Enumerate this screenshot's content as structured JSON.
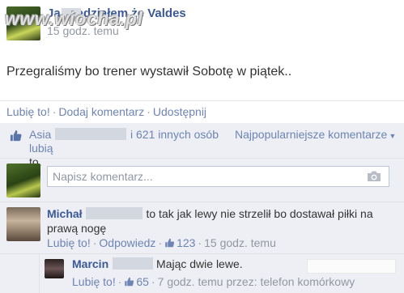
{
  "post": {
    "author": "Ja        wiedziałem że Valdes",
    "time": "15 godz. temu",
    "watermark": "www.wiocha.pl",
    "text": "Przegraliśmy bo trener wystawił Sobotę w piątek.."
  },
  "actions": {
    "like": "Lubię to!",
    "comment": "Dodaj komentarz",
    "share": "Udostępnij"
  },
  "likes": {
    "name": "Asia",
    "rest": "i 621 innych osób lubią",
    "suffix": "to.",
    "popular_label": "Najpopularniejsze komentarze"
  },
  "composer": {
    "placeholder": "Napisz komentarz..."
  },
  "comments": [
    {
      "author": "Michał",
      "text": "to tak jak lewy nie strzelił bo dostawał piłki na prawą nogę",
      "like_label": "Lubię to!",
      "reply_label": "Odpowiedz",
      "likes": "123",
      "time": "15 godz. temu"
    }
  ],
  "reply": {
    "author": "Marcin",
    "text": "Mając dwie lewe.",
    "like_label": "Lubię to!",
    "likes": "65",
    "time": "7 godz. temu przez: telefon komórkowy"
  },
  "colors": {
    "link": "#3b5998",
    "action": "#6d84b4",
    "meta": "#9197a3",
    "feedback_bg": "#edeff4"
  }
}
